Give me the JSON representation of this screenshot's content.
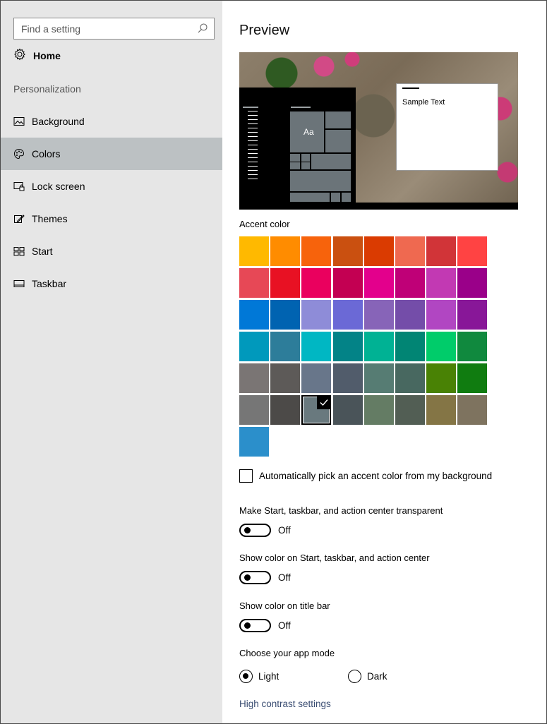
{
  "sidebar": {
    "search": {
      "placeholder": "Find a setting",
      "value": ""
    },
    "home_label": "Home",
    "section_label": "Personalization",
    "items": [
      {
        "label": "Background",
        "icon": "picture-icon",
        "selected": false
      },
      {
        "label": "Colors",
        "icon": "palette-icon",
        "selected": true
      },
      {
        "label": "Lock screen",
        "icon": "lock-screen-icon",
        "selected": false
      },
      {
        "label": "Themes",
        "icon": "themes-icon",
        "selected": false
      },
      {
        "label": "Start",
        "icon": "start-icon",
        "selected": false
      },
      {
        "label": "Taskbar",
        "icon": "taskbar-icon",
        "selected": false
      }
    ]
  },
  "main": {
    "title": "Preview",
    "preview": {
      "tile_label": "Aa",
      "sample_text": "Sample Text"
    },
    "accent_color_label": "Accent color",
    "accent_colors": [
      "#FFB900",
      "#FF8C00",
      "#F7630C",
      "#CA5010",
      "#DA3B01",
      "#EF6950",
      "#D13438",
      "#FF4343",
      "#E74856",
      "#E81123",
      "#EA005E",
      "#C30052",
      "#E3008C",
      "#BF0077",
      "#C239B3",
      "#9A0089",
      "#0078D7",
      "#0063B1",
      "#8E8CD8",
      "#6B69D6",
      "#8764B8",
      "#744DA9",
      "#B146C2",
      "#881798",
      "#0099BC",
      "#2D7D9A",
      "#00B7C3",
      "#038387",
      "#00B294",
      "#018574",
      "#00CC6A",
      "#10893E",
      "#7A7574",
      "#5D5A58",
      "#68768A",
      "#515C6B",
      "#567C73",
      "#486860",
      "#498205",
      "#107C10",
      "#767676",
      "#4C4A48",
      "#69797E",
      "#4A5459",
      "#647C64",
      "#525E54",
      "#847545",
      "#7E735F",
      "#2B8FCB"
    ],
    "selected_accent": "#69797E",
    "auto_pick_label": "Automatically pick an accent color from my background",
    "auto_pick_checked": false,
    "toggles": [
      {
        "label": "Make Start, taskbar, and action center transparent",
        "state": "Off"
      },
      {
        "label": "Show color on Start, taskbar, and action center",
        "state": "Off"
      },
      {
        "label": "Show color on title bar",
        "state": "Off"
      }
    ],
    "app_mode": {
      "label": "Choose your app mode",
      "options": [
        {
          "label": "Light",
          "selected": true
        },
        {
          "label": "Dark",
          "selected": false
        }
      ]
    },
    "high_contrast_link": "High contrast settings"
  }
}
